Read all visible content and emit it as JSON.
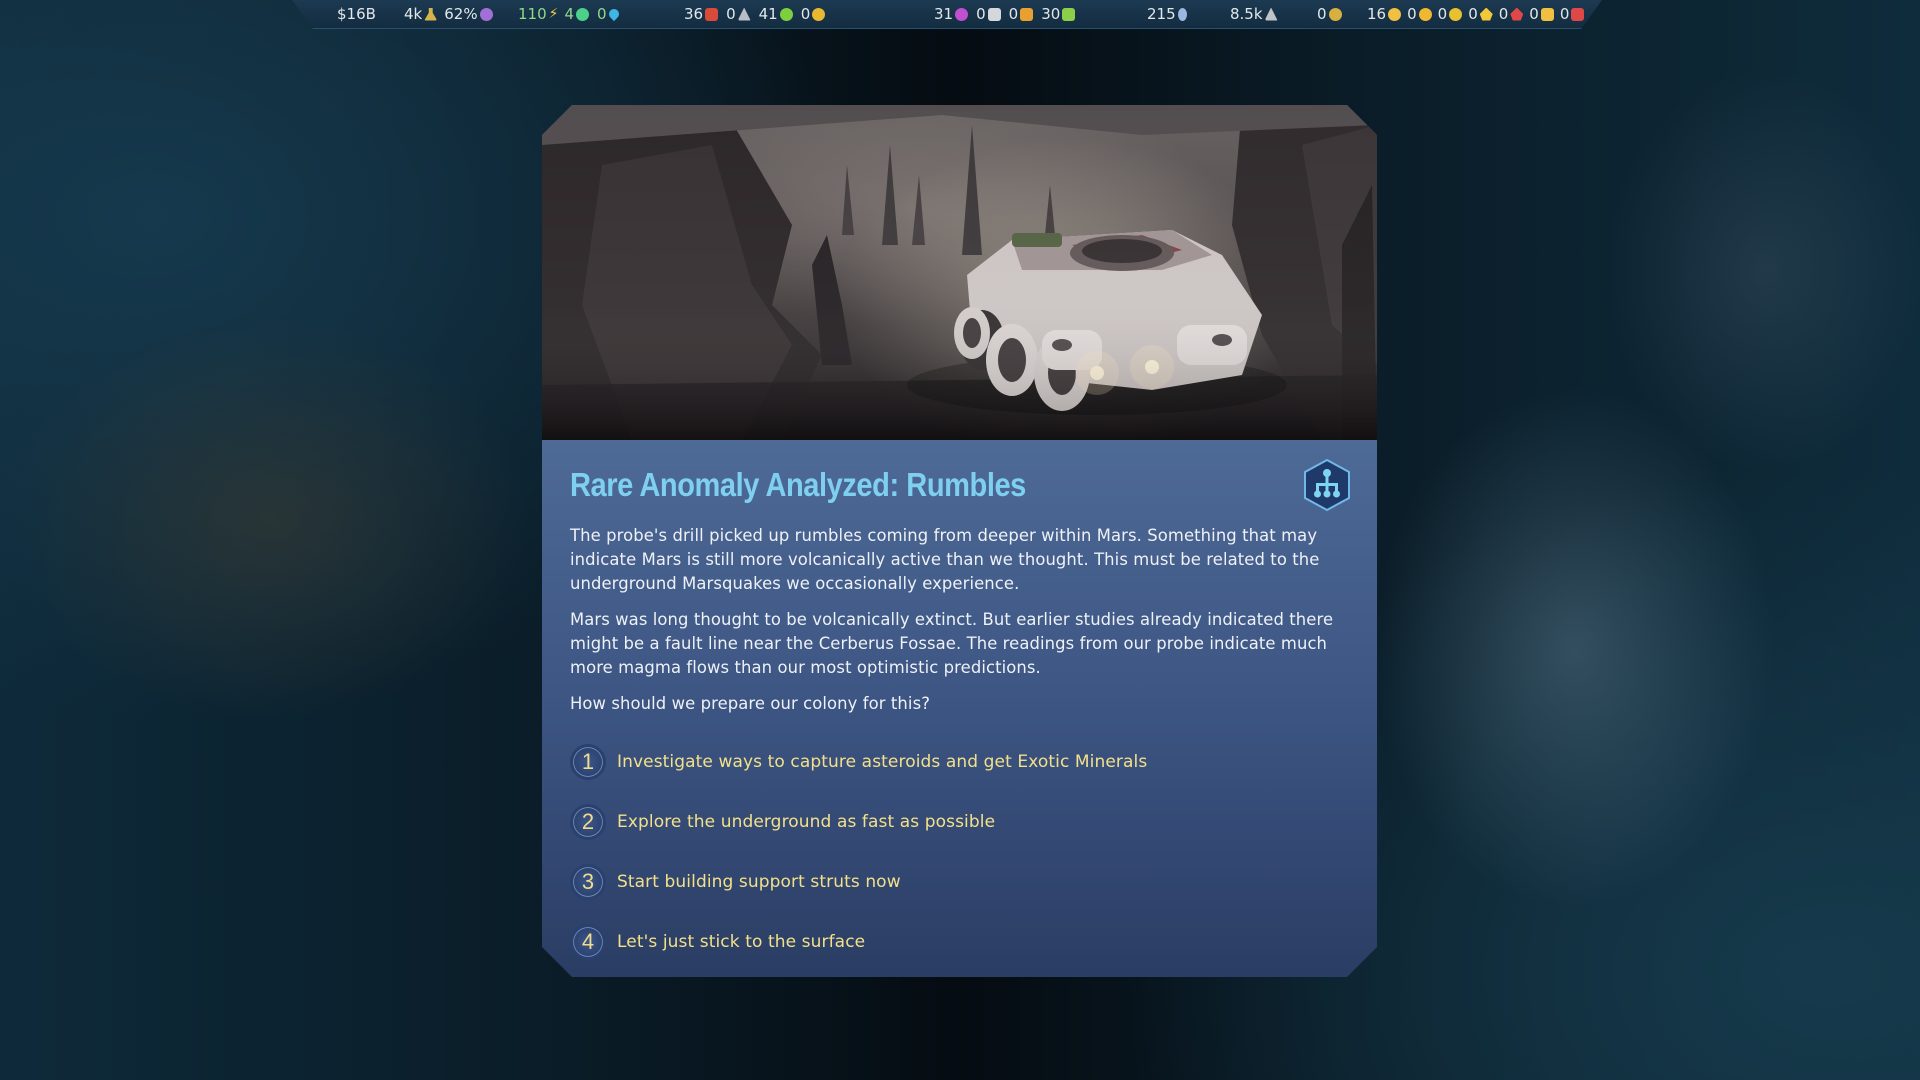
{
  "topbar": {
    "funding": "$16B",
    "research": "4k",
    "research_pct": "62%",
    "power": "110",
    "oxygen": "4",
    "water": "0",
    "concrete": "36",
    "metals": "0",
    "food": "41",
    "rare_metals": "0",
    "polymers": "31",
    "machine_parts": "0",
    "electronics": "0",
    "fuel": "30",
    "seeds": "215",
    "drones": "8.5k",
    "exotic_minerals": "0",
    "colonists": "16",
    "unemployed": "0",
    "homeless": "0",
    "tourists": "0",
    "seniors": "0",
    "children": "0"
  },
  "dialog": {
    "title": "Rare Anomaly Analyzed: Rumbles",
    "paragraph_1": "The probe's drill picked up rumbles coming from deeper within Mars. Something that may indicate Mars is still more volcanically active than we thought. This must be related to the underground Marsquakes we occasionally experience.",
    "paragraph_2": "Mars was long thought to be volcanically extinct. But earlier studies already indicated there might be a fault line near the Cerberus Fossae. The readings from our probe indicate much more magma flows than our most optimistic predictions.",
    "question": "How should we prepare our colony for this?",
    "choices": [
      {
        "num": "1",
        "label": "Investigate ways to capture asteroids and get Exotic Minerals"
      },
      {
        "num": "2",
        "label": "Explore the underground as fast as possible"
      },
      {
        "num": "3",
        "label": "Start building support struts now"
      },
      {
        "num": "4",
        "label": "Let's just stick to the surface"
      }
    ]
  },
  "icons": {
    "research_tree_badge": "tech-tree-icon",
    "accent_title": "#7fd0f0",
    "accent_choice": "#f3e08a"
  }
}
